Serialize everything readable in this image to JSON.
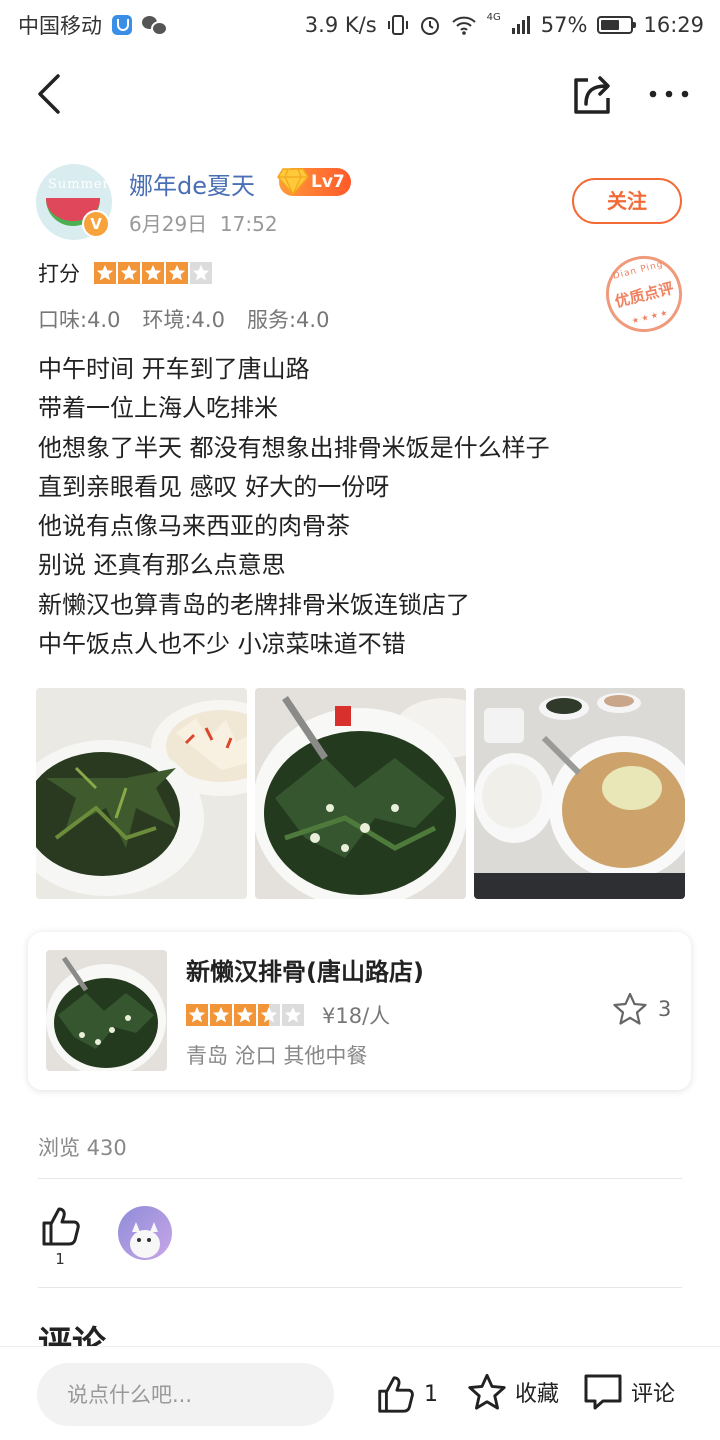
{
  "status_bar": {
    "carrier": "中国移动",
    "network_speed": "3.9 K/s",
    "signal_type": "4G",
    "battery": "57%",
    "time": "16:29",
    "icons": [
      "shield-icon",
      "wechat-icon",
      "vibrate-icon",
      "alarm-icon",
      "wifi-icon",
      "signal-icon",
      "battery-icon"
    ]
  },
  "nav": {
    "icons": [
      "back-icon",
      "share-icon",
      "more-icon"
    ]
  },
  "author": {
    "name": "娜年de夏天",
    "level": "Lv7",
    "avatar_text": "Summer",
    "verified_badge": "V",
    "date": "6月29日",
    "time": "17:52",
    "follow_label": "关注"
  },
  "rating": {
    "label": "打分",
    "stars": 4,
    "max_stars": 5,
    "taste": "口味:4.0",
    "environment": "环境:4.0",
    "service": "服务:4.0"
  },
  "seal": {
    "top": "Dian Ping",
    "main": "优质点评",
    "bottom": "★ ★ ★ ★"
  },
  "review_lines": [
    "中午时间 开车到了唐山路",
    "带着一位上海人吃排米",
    "他想象了半天 都没有想象出排骨米饭是什么样子",
    "直到亲眼看见 感叹 好大的一份呀",
    "他说有点像马来西亚的肉骨茶",
    "别说 还真有那么点意思",
    "新懒汉也算青岛的老牌排骨米饭连锁店了",
    "中午饭点人也不少 小凉菜味道不错"
  ],
  "photos_count": 3,
  "shop": {
    "name": "新懒汉排骨(唐山路店)",
    "stars": 3.5,
    "price": "¥18/人",
    "meta": "青岛 沧口 其他中餐",
    "favorites": "3"
  },
  "views": "浏览 430",
  "likes": {
    "count": "1"
  },
  "comments_title": "评论",
  "bottom_bar": {
    "input_placeholder": "说点什么吧...",
    "like_count": "1",
    "collect_label": "收藏",
    "comment_label": "评论"
  },
  "colors": {
    "accent": "#f26b36",
    "star": "#f29438",
    "username": "#4a6fb5"
  }
}
